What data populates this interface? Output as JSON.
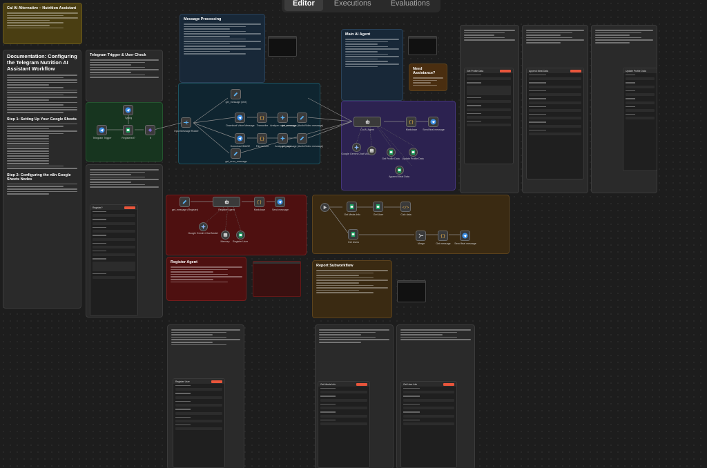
{
  "tabs": {
    "editor": "Editor",
    "executions": "Executions",
    "evaluations": "Evaluations"
  },
  "stickies": {
    "cal_ai_title": "Cal AI Alternative – Nutrition Assistant",
    "documentation_title": "Documentation: Configuring the Telegram Nutrition AI Assistant Workflow",
    "step1": "Step 1: Setting Up Your Google Sheets",
    "step2": "Step 2: Configuring the n8n Google Sheets Nodes",
    "telegram_trigger_title": "Telegram Trigger & User Check",
    "message_processing_title": "Message Processing",
    "main_ai_agent_title": "Main AI Agent",
    "need_assistance_title": "Need Assistance?",
    "register_agent_title": "Register Agent",
    "report_subworkflow_title": "Report Subworkflow"
  },
  "nodes": {
    "telegram_trigger": "Telegram Trigger",
    "typing": "Typing",
    "registered": "Registered?",
    "if": "If",
    "input_message_router": "Input Message Router",
    "get_message_text": "get_message (text)",
    "download_voice_message": "Download Voice Message",
    "transcribe": "Transcribe",
    "analyze_voice_message": "Analyze voice message",
    "get_message_audio": "get_message (Audio/Video message)",
    "download_image": "Download IMAGE",
    "file_content": "File content",
    "analyze_image": "Analyze image",
    "get_message_image": "get_message (Audio/Video message)",
    "get_error_message": "get_error_message",
    "cal_ai_agent": "Cal AI Agent",
    "markdown": "Markdown",
    "send_final_message": "Send final message",
    "google_gemini_chat": "Google Gemini Chat Model",
    "memory": "Memory",
    "get_profile_data": "Get Profile Data",
    "update_profile_data": "Update Profile Data",
    "append_meal_data": "Append Meal Data",
    "get_message_register": "get_message (Register)",
    "register_agent": "Register Agent",
    "send_message": "Send message",
    "register_user": "Register User",
    "get_meals_info": "Get Meals Info",
    "get_user": "Get User",
    "get_users": "Get Users",
    "calc_data": "Calc data",
    "merge": "Merge",
    "get_message": "Get message",
    "send_final_message2": "Send final message"
  },
  "panel_titles": {
    "register": "Register?",
    "profile_data": "Get Profile Data",
    "append_meal": "Append Meal Data",
    "update_profile": "Update Profile Data",
    "register_user": "Register User",
    "get_meals": "Get Meals Info",
    "get_users": "Get User Info"
  },
  "colors": {
    "canvas": "#1d1d1d",
    "accent": "#e8553b",
    "trigger": "#3a8ee6"
  }
}
